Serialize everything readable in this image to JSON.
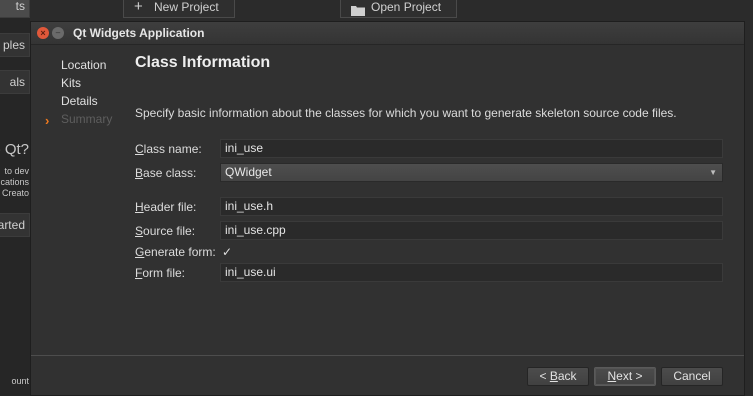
{
  "background": {
    "tabs": [
      {
        "label": "ts"
      },
      {
        "label": "ples"
      },
      {
        "label": "als"
      }
    ],
    "side_texts": [
      {
        "text": "o Qt?"
      },
      {
        "text": "to dev"
      },
      {
        "text": "cations"
      },
      {
        "text": ": Creato"
      },
      {
        "text": "arted"
      },
      {
        "text": "ount"
      }
    ],
    "new_project_label": "New Project",
    "open_project_label": "Open Project"
  },
  "dialog": {
    "title": "Qt Widgets Application",
    "steps": [
      "Location",
      "Kits",
      "Details",
      "Summary"
    ],
    "heading": "Class Information",
    "description": "Specify basic information about the classes for which you want to generate skeleton source code files.",
    "fields": {
      "class_name": {
        "label_pre": "",
        "label_mn": "C",
        "label_post": "lass name:",
        "value": "ini_use"
      },
      "base_class": {
        "label_pre": "",
        "label_mn": "B",
        "label_post": "ase class:",
        "value": "QWidget"
      },
      "header_file": {
        "label_pre": "",
        "label_mn": "H",
        "label_post": "eader file:",
        "value": "ini_use.h"
      },
      "source_file": {
        "label_pre": "",
        "label_mn": "S",
        "label_post": "ource file:",
        "value": "ini_use.cpp"
      },
      "generate_form": {
        "label_pre": "",
        "label_mn": "G",
        "label_post": "enerate form:",
        "checked_mark": "✓"
      },
      "form_file": {
        "label_pre": "",
        "label_mn": "F",
        "label_post": "orm file:",
        "value": "ini_use.ui"
      }
    },
    "buttons": {
      "back": {
        "pre": "< ",
        "mn": "B",
        "post": "ack"
      },
      "next": {
        "pre": "",
        "mn": "N",
        "post": "ext >"
      },
      "cancel": "Cancel"
    }
  },
  "icons": {
    "new_project": "plus-icon",
    "open_project": "folder-icon",
    "close": "close-icon",
    "minimize": "minimize-icon",
    "current_step": "chevron-right-icon",
    "combo": "chevron-down-icon"
  },
  "colors": {
    "accent": "#f07a1e",
    "close_button": "#e0583a"
  }
}
